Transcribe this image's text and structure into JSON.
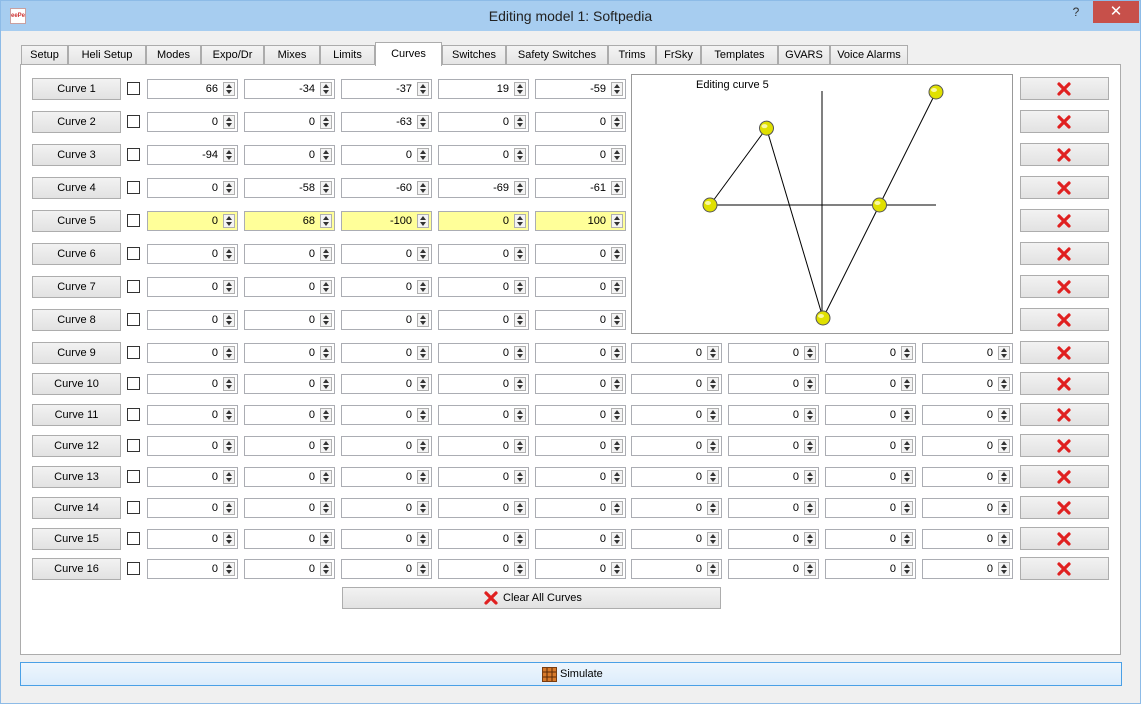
{
  "window": {
    "title": "Editing model 1: Softpedia",
    "app_icon": "eePe",
    "help_label": "?",
    "close_label": "✕"
  },
  "tabs": [
    {
      "label": "Setup",
      "active": false
    },
    {
      "label": "Heli Setup",
      "active": false
    },
    {
      "label": "Modes",
      "active": false
    },
    {
      "label": "Expo/Dr",
      "active": false
    },
    {
      "label": "Mixes",
      "active": false
    },
    {
      "label": "Limits",
      "active": false
    },
    {
      "label": "Curves",
      "active": true
    },
    {
      "label": "Switches",
      "active": false
    },
    {
      "label": "Safety Switches",
      "active": false
    },
    {
      "label": "Trims",
      "active": false
    },
    {
      "label": "FrSky",
      "active": false
    },
    {
      "label": "Templates",
      "active": false
    },
    {
      "label": "GVARS",
      "active": false
    },
    {
      "label": "Voice Alarms",
      "active": false
    }
  ],
  "curves": [
    {
      "label": "Curve 1",
      "values": [
        66,
        -34,
        -37,
        19,
        -59
      ],
      "highlighted": false
    },
    {
      "label": "Curve 2",
      "values": [
        0,
        0,
        -63,
        0,
        0
      ],
      "highlighted": false
    },
    {
      "label": "Curve 3",
      "values": [
        -94,
        0,
        0,
        0,
        0
      ],
      "highlighted": false
    },
    {
      "label": "Curve 4",
      "values": [
        0,
        -58,
        -60,
        -69,
        -61
      ],
      "highlighted": false
    },
    {
      "label": "Curve 5",
      "values": [
        0,
        68,
        -100,
        0,
        100
      ],
      "highlighted": true
    },
    {
      "label": "Curve 6",
      "values": [
        0,
        0,
        0,
        0,
        0
      ],
      "highlighted": false
    },
    {
      "label": "Curve 7",
      "values": [
        0,
        0,
        0,
        0,
        0
      ],
      "highlighted": false
    },
    {
      "label": "Curve 8",
      "values": [
        0,
        0,
        0,
        0,
        0
      ],
      "highlighted": false
    },
    {
      "label": "Curve 9",
      "values": [
        0,
        0,
        0,
        0,
        0,
        0,
        0,
        0,
        0
      ],
      "highlighted": false
    },
    {
      "label": "Curve 10",
      "values": [
        0,
        0,
        0,
        0,
        0,
        0,
        0,
        0,
        0
      ],
      "highlighted": false
    },
    {
      "label": "Curve 11",
      "values": [
        0,
        0,
        0,
        0,
        0,
        0,
        0,
        0,
        0
      ],
      "highlighted": false
    },
    {
      "label": "Curve 12",
      "values": [
        0,
        0,
        0,
        0,
        0,
        0,
        0,
        0,
        0
      ],
      "highlighted": false
    },
    {
      "label": "Curve 13",
      "values": [
        0,
        0,
        0,
        0,
        0,
        0,
        0,
        0,
        0
      ],
      "highlighted": false
    },
    {
      "label": "Curve 14",
      "values": [
        0,
        0,
        0,
        0,
        0,
        0,
        0,
        0,
        0
      ],
      "highlighted": false
    },
    {
      "label": "Curve 15",
      "values": [
        0,
        0,
        0,
        0,
        0,
        0,
        0,
        0,
        0
      ],
      "highlighted": false
    },
    {
      "label": "Curve 16",
      "values": [
        0,
        0,
        0,
        0,
        0,
        0,
        0,
        0,
        0
      ],
      "highlighted": false
    }
  ],
  "graph": {
    "title": "Editing curve 5",
    "points": [
      0,
      68,
      -100,
      0,
      100
    ],
    "point_color": "#e0e000"
  },
  "clear_all_label": "Clear All Curves",
  "simulate_label": "Simulate",
  "icons": {
    "delete": "red-x-icon",
    "simulate": "grid-icon"
  },
  "colors": {
    "highlight": "#ffff99",
    "delete": "#e02020",
    "titlebar": "#a7cdf0",
    "close": "#c7504a"
  }
}
